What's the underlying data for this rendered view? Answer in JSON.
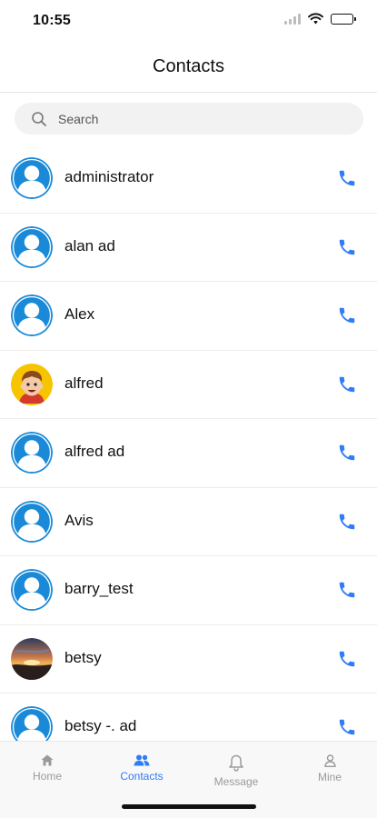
{
  "status_bar": {
    "time": "10:55"
  },
  "header": {
    "title": "Contacts"
  },
  "search": {
    "placeholder": "Search"
  },
  "contacts": [
    {
      "name": "administrator",
      "avatar": "default-avatar"
    },
    {
      "name": "alan ad",
      "avatar": "default-avatar"
    },
    {
      "name": "Alex",
      "avatar": "default-avatar"
    },
    {
      "name": "alfred",
      "avatar": "cartoon-boy-avatar"
    },
    {
      "name": "alfred ad",
      "avatar": "default-avatar"
    },
    {
      "name": "Avis",
      "avatar": "default-avatar"
    },
    {
      "name": "barry_test",
      "avatar": "default-avatar"
    },
    {
      "name": "betsy",
      "avatar": "sunset-photo-avatar"
    },
    {
      "name": "betsy -. ad",
      "avatar": "default-avatar"
    }
  ],
  "tabs": [
    {
      "label": "Home",
      "icon": "home-icon",
      "active": false
    },
    {
      "label": "Contacts",
      "icon": "contacts-icon",
      "active": true
    },
    {
      "label": "Message",
      "icon": "bell-icon",
      "active": false
    },
    {
      "label": "Mine",
      "icon": "person-icon",
      "active": false
    }
  ],
  "colors": {
    "accent": "#2f7df6",
    "avatar_blue": "#1a8ad8",
    "inactive_tab": "#9a9a9a"
  }
}
